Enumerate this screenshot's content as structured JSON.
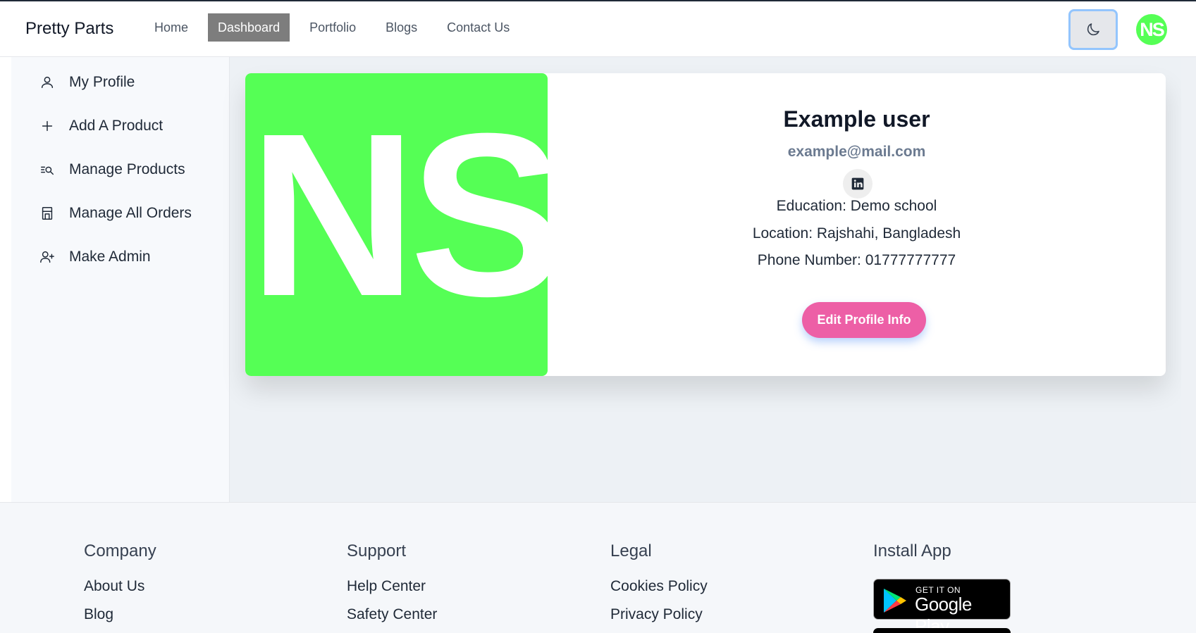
{
  "navbar": {
    "brand": "Pretty Parts",
    "links": [
      {
        "label": "Home"
      },
      {
        "label": "Dashboard",
        "active": true
      },
      {
        "label": "Portfolio"
      },
      {
        "label": "Blogs"
      },
      {
        "label": "Contact Us"
      }
    ],
    "theme_icon": "moon-icon",
    "avatar_initials": "NS"
  },
  "sidebar": {
    "items": [
      {
        "label": "My Profile",
        "icon": "user-icon"
      },
      {
        "label": "Add A Product",
        "icon": "plus-icon"
      },
      {
        "label": "Manage Products",
        "icon": "list-search-icon"
      },
      {
        "label": "Manage All Orders",
        "icon": "store-icon"
      },
      {
        "label": "Make Admin",
        "icon": "user-plus-icon"
      }
    ]
  },
  "profile": {
    "avatar_initials": "NS",
    "name": "Example user",
    "email": "example@mail.com",
    "social_icon": "linkedin-icon",
    "education": "Education: Demo school",
    "location": "Location: Rajshahi, Bangladesh",
    "phone": "Phone Number: 01777777777",
    "edit_button": "Edit Profile Info"
  },
  "footer": {
    "columns": [
      {
        "heading": "Company",
        "links": [
          "About Us",
          "Blog"
        ]
      },
      {
        "heading": "Support",
        "links": [
          "Help Center",
          "Safety Center"
        ]
      },
      {
        "heading": "Legal",
        "links": [
          "Cookies Policy",
          "Privacy Policy"
        ]
      },
      {
        "heading": "Install App",
        "links": []
      }
    ],
    "store_badge": {
      "small": "GET IT ON",
      "big": "Google Play"
    }
  },
  "colors": {
    "avatar_green": "#55ff55",
    "active_nav": "#7d7d7d",
    "edit_button": "#ed5fa6",
    "email_text": "#6b7a90"
  }
}
